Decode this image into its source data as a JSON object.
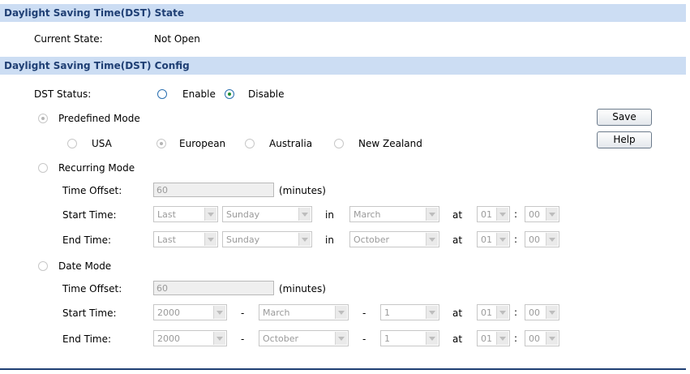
{
  "state_section": {
    "header": "Daylight Saving Time(DST) State",
    "current_state_label": "Current State:",
    "current_state_value": "Not Open"
  },
  "config_section": {
    "header": "Daylight Saving Time(DST) Config",
    "dst_status_label": "DST Status:",
    "enable_label": "Enable",
    "disable_label": "Disable",
    "selected_status": "Disable"
  },
  "predefined": {
    "label": "Predefined Mode",
    "options": [
      "USA",
      "European",
      "Australia",
      "New Zealand"
    ],
    "selected": "European"
  },
  "recurring": {
    "label": "Recurring Mode",
    "time_offset_label": "Time Offset:",
    "time_offset_value": "60",
    "minutes_label": "(minutes)",
    "start_label": "Start Time:",
    "end_label": "End Time:",
    "in_label": "in",
    "at_label": "at",
    "colon": ":",
    "start": {
      "week": "Last",
      "day": "Sunday",
      "month": "March",
      "hour": "01",
      "minute": "00"
    },
    "end": {
      "week": "Last",
      "day": "Sunday",
      "month": "October",
      "hour": "01",
      "minute": "00"
    }
  },
  "date_mode": {
    "label": "Date Mode",
    "time_offset_label": "Time Offset:",
    "time_offset_value": "60",
    "minutes_label": "(minutes)",
    "start_label": "Start Time:",
    "end_label": "End Time:",
    "dash": "-",
    "at_label": "at",
    "colon": ":",
    "start": {
      "year": "2000",
      "month": "March",
      "day": "1",
      "hour": "01",
      "minute": "00"
    },
    "end": {
      "year": "2000",
      "month": "October",
      "day": "1",
      "hour": "01",
      "minute": "00"
    }
  },
  "buttons": {
    "save": "Save",
    "help": "Help"
  },
  "colors": {
    "header_bg": "#ccddf3",
    "header_text": "#1f3f74",
    "radio_selected": "#1e8d2f"
  }
}
